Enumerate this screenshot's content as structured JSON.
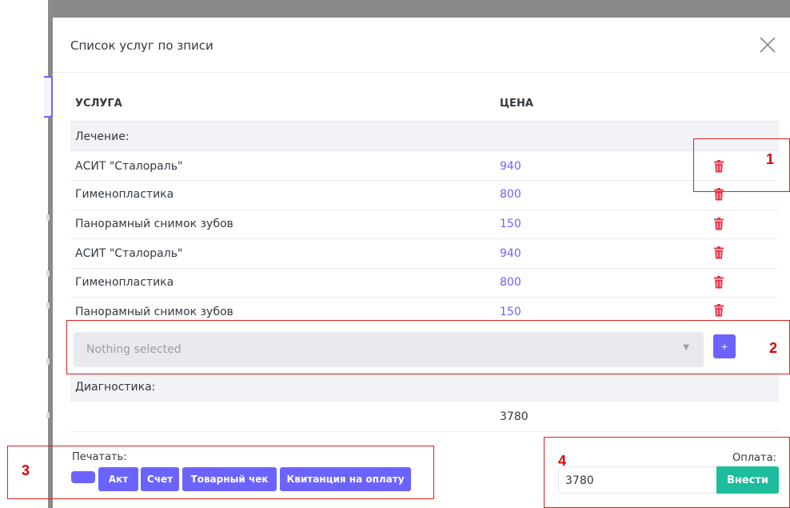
{
  "modal": {
    "title": "Список услуг по зписи"
  },
  "table": {
    "headers": {
      "service": "УСЛУГА",
      "price": "ЦЕНА"
    },
    "groups": [
      {
        "label": "Лечение:",
        "rows": [
          {
            "name": "АСИТ \"Сталораль\"",
            "price": "940"
          },
          {
            "name": "Гименопластика",
            "price": "800"
          },
          {
            "name": "Панорамный снимок зубов",
            "price": "150"
          },
          {
            "name": "АСИТ \"Сталораль\"",
            "price": "940"
          },
          {
            "name": "Гименопластика",
            "price": "800"
          },
          {
            "name": "Панорамный снимок зубов",
            "price": "150"
          }
        ]
      },
      {
        "label": "Диагностика:",
        "rows": []
      }
    ],
    "total": "3780"
  },
  "service_select": {
    "placeholder": "Nothing selected",
    "add_label": "+"
  },
  "print": {
    "label": "Печатать:",
    "buttons": [
      "",
      "Акт",
      "Счет",
      "Товарный чек",
      "Квитанция на оплату"
    ]
  },
  "payment": {
    "label": "Оплата:",
    "value": "3780",
    "submit_label": "Внести"
  },
  "annotations": [
    "1",
    "2",
    "3",
    "4"
  ],
  "colors": {
    "accent": "#6c63ff",
    "danger": "#e8334a",
    "success": "#1cbc9c",
    "annotation": "#e00000"
  }
}
